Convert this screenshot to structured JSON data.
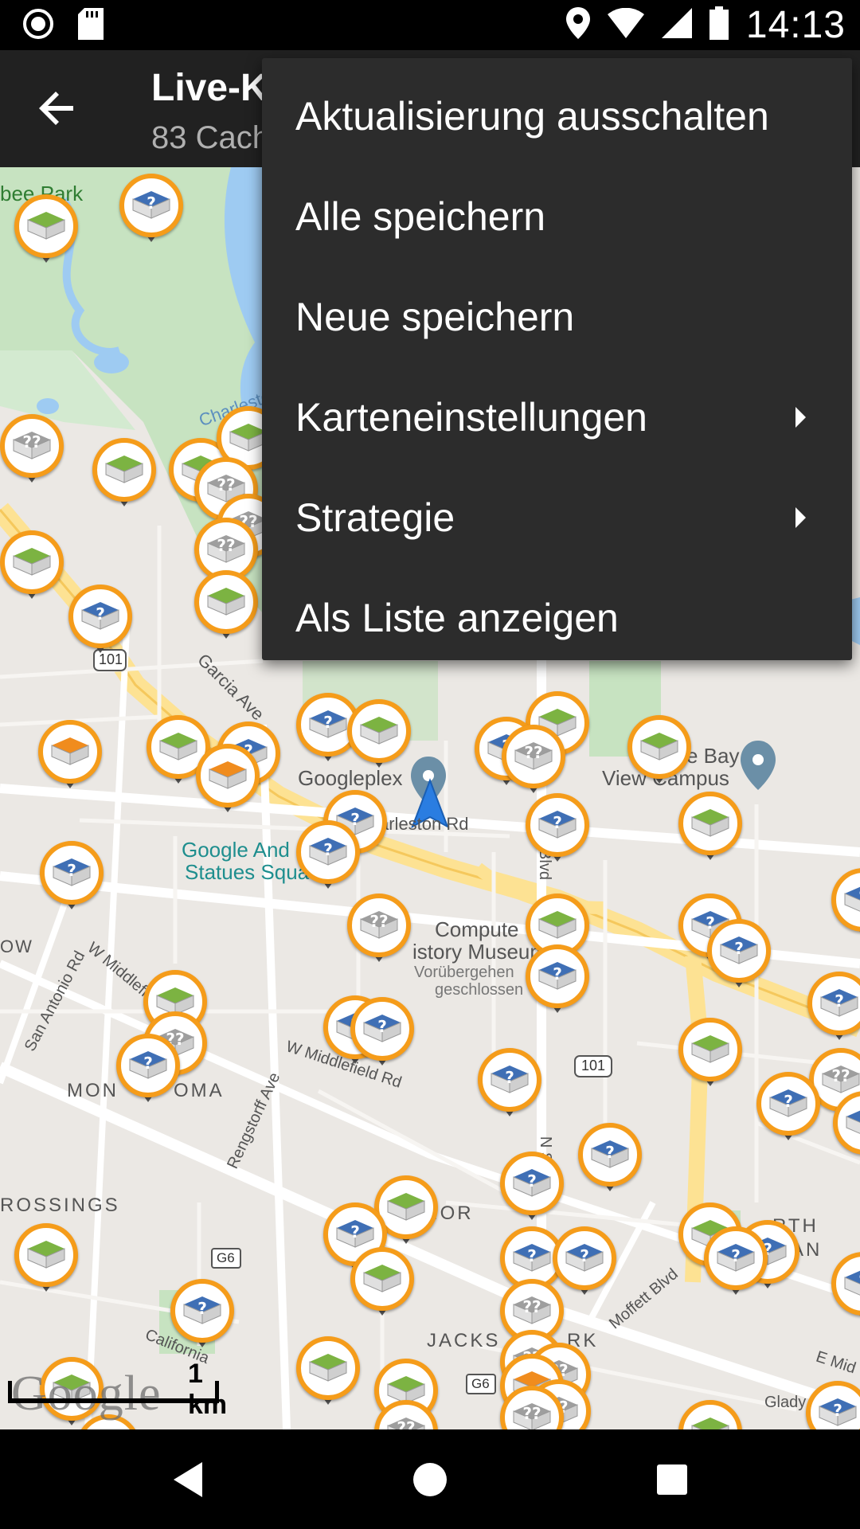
{
  "status_bar": {
    "time": "14:13",
    "icons": [
      "record-icon",
      "sd-card-icon",
      "location-icon",
      "wifi-icon",
      "signal-icon",
      "battery-icon"
    ]
  },
  "toolbar": {
    "title": "Live-K",
    "subtitle": "83 Cach",
    "back_icon": "arrow-back-icon"
  },
  "menu": {
    "items": [
      {
        "label": "Aktualisierung ausschalten",
        "has_submenu": false
      },
      {
        "label": "Alle speichern",
        "has_submenu": false
      },
      {
        "label": "Neue speichern",
        "has_submenu": false
      },
      {
        "label": "Karteneinstellungen",
        "has_submenu": true
      },
      {
        "label": "Strategie",
        "has_submenu": true
      },
      {
        "label": "Als Liste anzeigen",
        "has_submenu": false
      }
    ]
  },
  "map": {
    "labels": {
      "park": "bee Park",
      "charleston": "Charlesto",
      "garcia": "Garcia Ave",
      "googleplex": "Googleplex",
      "charleston_rd": "arleston Rd",
      "google_statues_1": "Google And",
      "google_statues_2": "Statues Squa",
      "bay_view_1": "e Bay",
      "bay_view_2": "View Campus",
      "computer_1": "Compute",
      "computer_2": "istory Museum",
      "temp_closed_1": "Vorübergehen",
      "temp_closed_2": "geschlossen",
      "w_middlefield_1": "W Middlefie",
      "w_middlefield_2": "W Middlefield Rd",
      "san_antonio": "San Antonio Rd",
      "ow": "OW",
      "monta_loma_1": "MON",
      "monta_loma_2": "OMA",
      "rengstorff": "Rengstorff Ave",
      "crossings": "ROSSINGS",
      "manor": "Y MANOR",
      "jackson_park_1": "JACKS",
      "jackson_park_2": "RK",
      "moffett": "Moffett Blvd",
      "california": "California",
      "north_1": "RTH",
      "north_2": "MAN",
      "e_mid": "E Mid",
      "glad": "Glady",
      "n_shoreline": "N S",
      "blvd": "Blvd",
      "route_101_a": "101",
      "route_101_b": "101",
      "route_g6_a": "G6",
      "route_g6_b": "G6"
    },
    "scale_label": "1 km",
    "watermark": "Google",
    "colors": {
      "marker_ring": "#f59c1a",
      "traditional_cache": "#7cb342",
      "unknown_cache": "#9e9e9e",
      "mystery_cache": "#3f6fb5",
      "multi_cache": "#f08c1e",
      "water": "#9ecbf2",
      "park": "#c8e6c9",
      "highway": "#fde293"
    }
  },
  "nav_bar": {
    "icons": [
      "back-triangle-icon",
      "home-circle-icon",
      "recents-square-icon"
    ]
  }
}
